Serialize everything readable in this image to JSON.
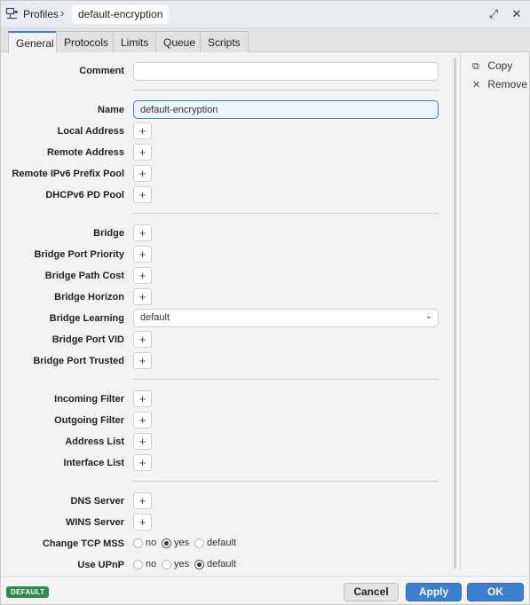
{
  "titlebar": {
    "breadcrumb_parent": "Profiles",
    "separator": "›",
    "current": "default-encryption",
    "restore_glyph": "⤢",
    "close_glyph": "✕"
  },
  "tabs": [
    {
      "label": "General",
      "active": true
    },
    {
      "label": "Protocols",
      "active": false
    },
    {
      "label": "Limits",
      "active": false
    },
    {
      "label": "Queue",
      "active": false
    },
    {
      "label": "Scripts",
      "active": false
    }
  ],
  "form": {
    "comment": {
      "label": "Comment",
      "value": ""
    },
    "name": {
      "label": "Name",
      "value": "default-encryption"
    },
    "local_address": {
      "label": "Local Address"
    },
    "remote_address": {
      "label": "Remote Address"
    },
    "remote_ipv6_prefix_pool": {
      "label": "Remote IPv6 Prefix Pool"
    },
    "dhcpv6_pd_pool": {
      "label": "DHCPv6 PD Pool"
    },
    "bridge": {
      "label": "Bridge"
    },
    "bridge_port_priority": {
      "label": "Bridge Port Priority"
    },
    "bridge_path_cost": {
      "label": "Bridge Path Cost"
    },
    "bridge_horizon": {
      "label": "Bridge Horizon"
    },
    "bridge_learning": {
      "label": "Bridge Learning",
      "value": "default"
    },
    "bridge_port_vid": {
      "label": "Bridge Port VID"
    },
    "bridge_port_trusted": {
      "label": "Bridge Port Trusted"
    },
    "incoming_filter": {
      "label": "Incoming Filter"
    },
    "outgoing_filter": {
      "label": "Outgoing Filter"
    },
    "address_list": {
      "label": "Address List"
    },
    "interface_list": {
      "label": "Interface List"
    },
    "dns_server": {
      "label": "DNS Server"
    },
    "wins_server": {
      "label": "WINS Server"
    },
    "change_tcp_mss": {
      "label": "Change TCP MSS",
      "options": [
        "no",
        "yes",
        "default"
      ],
      "selected": "yes"
    },
    "use_upnp": {
      "label": "Use UPnP",
      "options": [
        "no",
        "yes",
        "default"
      ],
      "selected": "default"
    },
    "add_glyph": "+"
  },
  "side_panel": {
    "copy_label": "Copy",
    "remove_label": "Remove",
    "copy_glyph": "⧉",
    "remove_glyph": "✕"
  },
  "footer": {
    "badge": "DEFAULT",
    "cancel_label": "Cancel",
    "apply_label": "Apply",
    "ok_label": "OK"
  },
  "colors": {
    "accent": "#3a7fd0",
    "badge_green": "#2f8a4e"
  }
}
